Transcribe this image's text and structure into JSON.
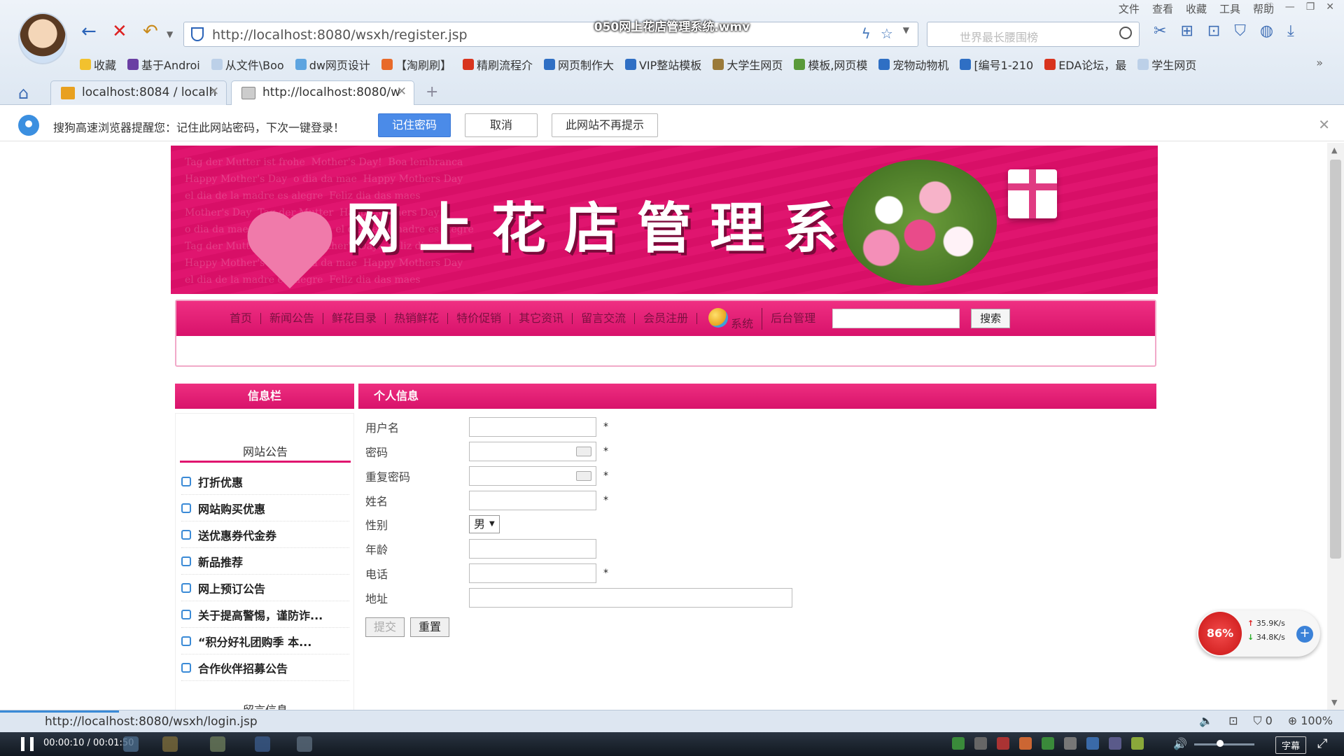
{
  "video": {
    "title": "050网上花店管理系统.wmv",
    "time": "00:00:10 / 00:01:50"
  },
  "browser": {
    "menu": [
      "文件",
      "查看",
      "收藏",
      "工具",
      "帮助"
    ],
    "address": "http://localhost:8080/wsxh/register.jsp",
    "search_placeholder": "世界最长腰围榜",
    "bookmarks": [
      "收藏",
      "基于Androi",
      "从文件\\Boo",
      "dw网页设计",
      "【淘刷刷】",
      "精刷流程介",
      "网页制作大",
      "VIP整站模板",
      "大学生网页",
      "模板,网页模",
      "宠物动物机",
      "[编号1-210",
      "EDA论坛，最",
      "学生网页"
    ],
    "tabs": [
      {
        "label": "localhost:8084 / localh",
        "active": false
      },
      {
        "label": "http://localhost:8080/w",
        "active": true
      }
    ],
    "notice": {
      "message": "搜狗高速浏览器提醒您：记住此网站密码，下次一键登录！",
      "remember": "记住密码",
      "cancel": "取消",
      "never": "此网站不再提示"
    },
    "status_url": "http://localhost:8080/wsxh/login.jsp",
    "status_right": {
      "count": "0",
      "zoom": "100%"
    }
  },
  "site": {
    "banner_title": "网上花店管理系统",
    "banner_ghost": "Tag der Mutter ist frohe  Mother's Day!  Boa lembranca\nHappy Mother's Day  o dia da mae  Happy Mothers Day\nel dia de la madre es alegre  Feliz dia das maes\nMother's Day  Tag der Mutter  Happy Mothers Day\no dia da mae  Boa lembranca  el dia de la madre es alegre\nTag der Mutter ist frohe  Mother's Day!  Feliz dia\nHappy Mother's Day  o dia da mae  Happy Mothers Day\nel dia de la madre es alegre  Feliz dia das maes",
    "nav": [
      "首页",
      "新闻公告",
      "鲜花目录",
      "热销鲜花",
      "特价促销",
      "其它资讯",
      "留言交流",
      "会员注册",
      "系统",
      "后台管理"
    ],
    "search_button": "搜索",
    "sidebar": {
      "title": "信息栏",
      "subtitle": "网站公告",
      "items": [
        "打折优惠",
        "网站购买优惠",
        "送优惠券代金券",
        "新品推荐",
        "网上预订公告",
        "关于提高警惕，谨防诈...",
        "“积分好礼团购季 本...",
        "合作伙伴招募公告"
      ],
      "subtitle2": "留言信息"
    },
    "form": {
      "title": "个人信息",
      "username_label": "用户名",
      "password_label": "密码",
      "confirm_label": "重复密码",
      "name_label": "姓名",
      "gender_label": "性别",
      "gender_value": "男",
      "age_label": "年龄",
      "phone_label": "电话",
      "address_label": "地址",
      "required_mark": "*",
      "submit": "提交",
      "reset": "重置"
    }
  },
  "speed_widget": {
    "percent": "86%",
    "up": "35.9K/s",
    "down": "34.8K/s"
  },
  "colors": {
    "brand_pink": "#e0156f",
    "link_blue": "#3a8ad6"
  }
}
